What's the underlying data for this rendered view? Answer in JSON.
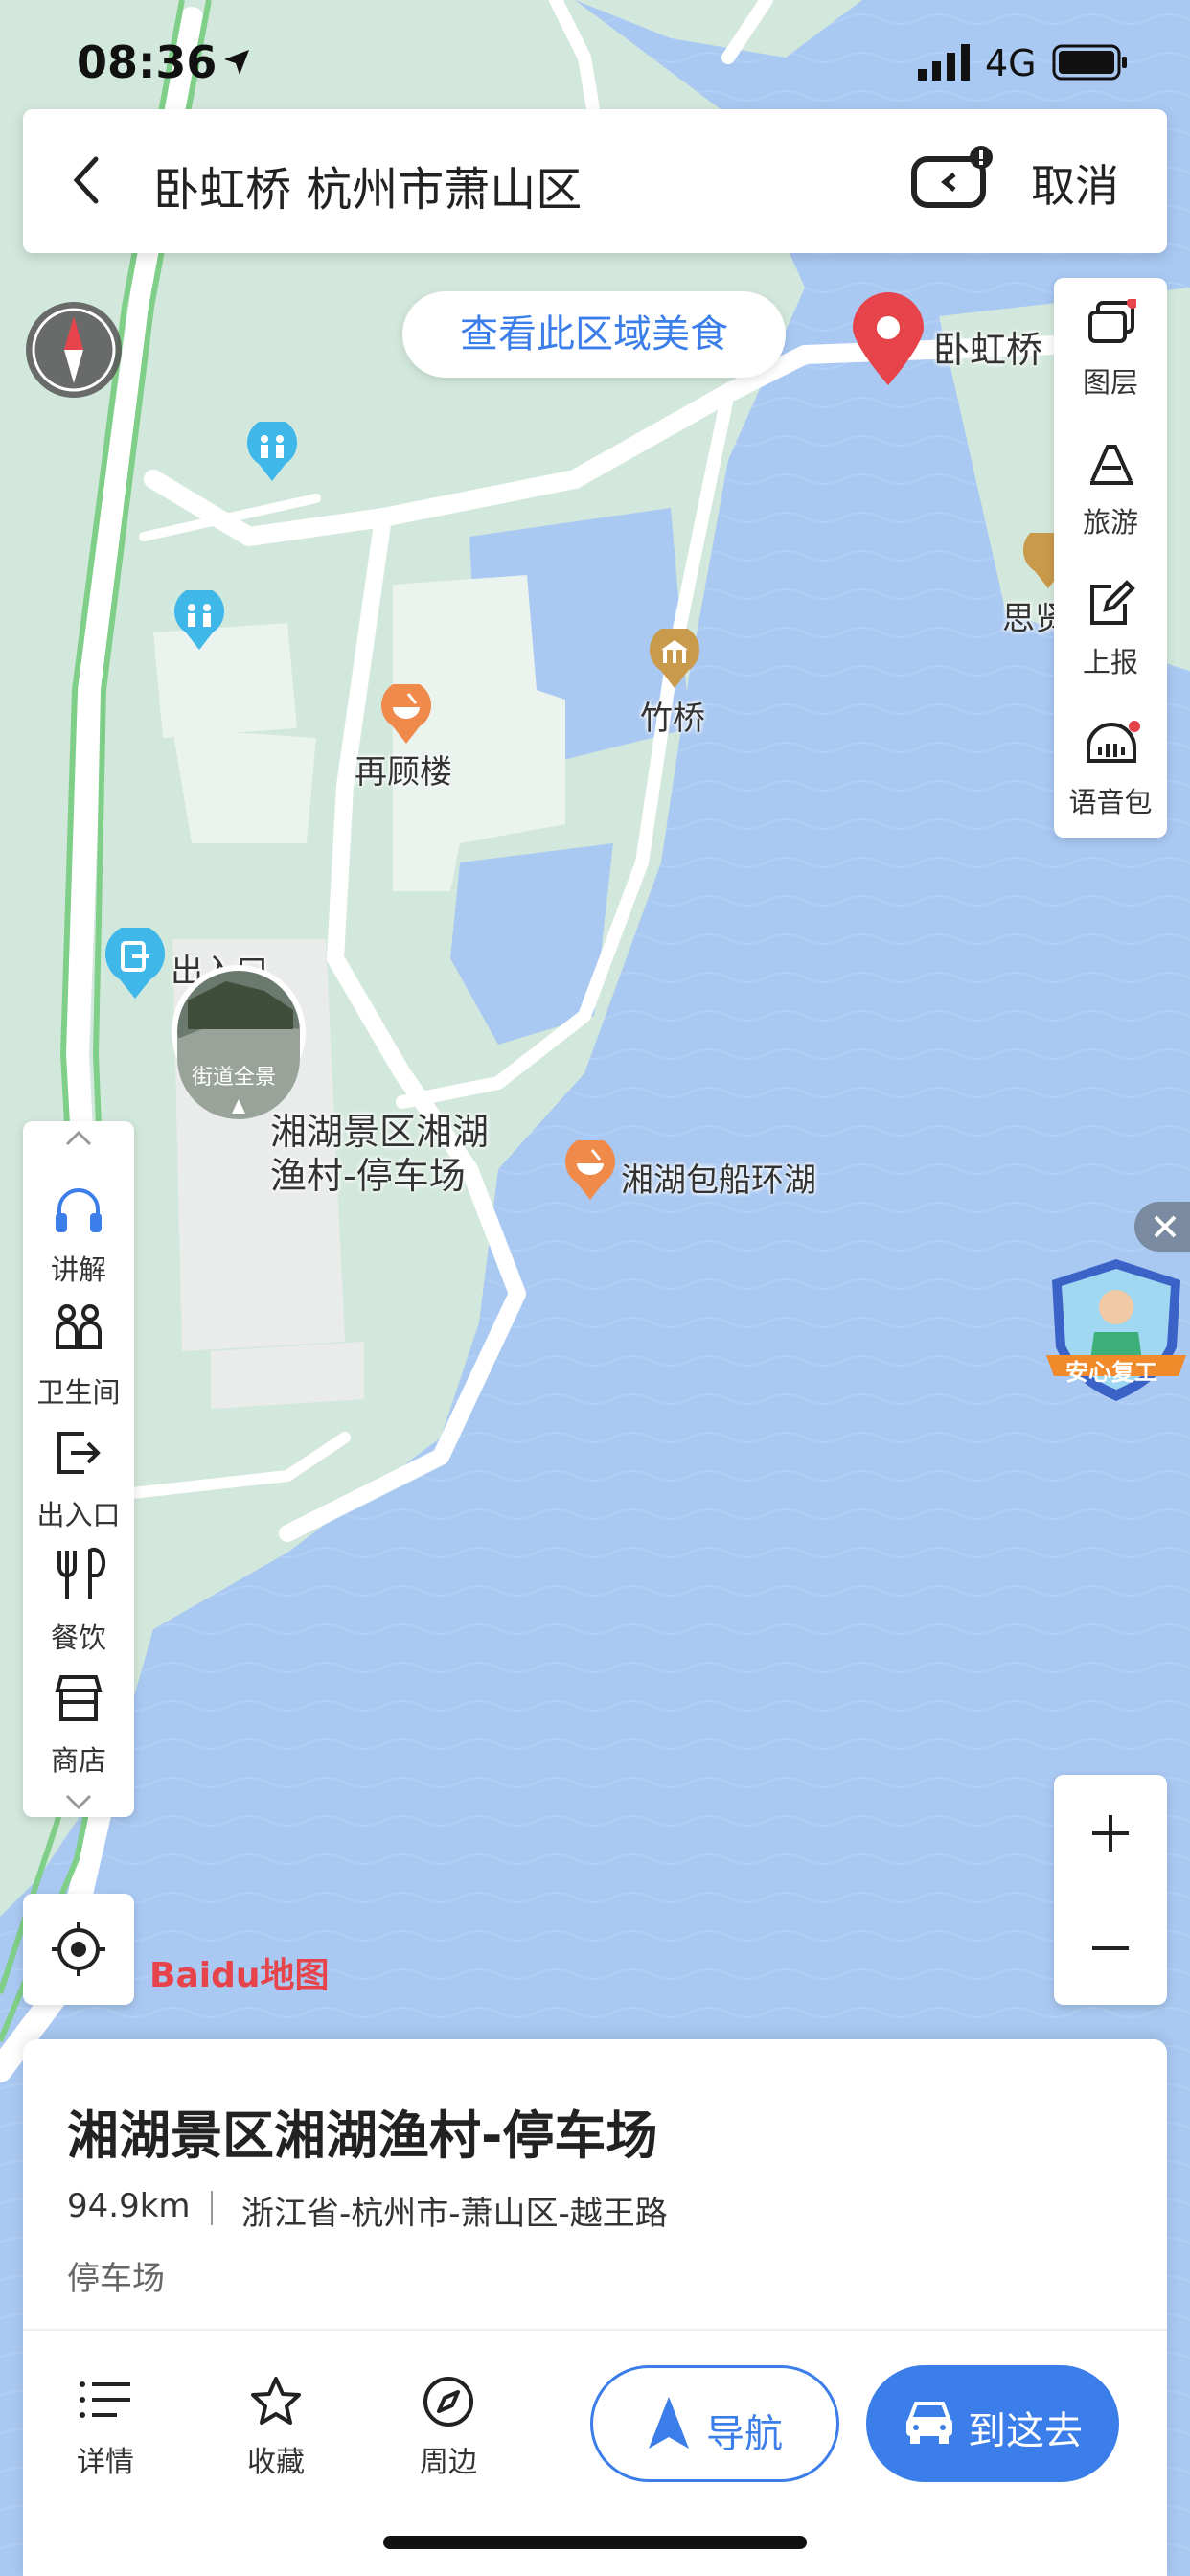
{
  "status_bar": {
    "time": "08:36",
    "network": "4G"
  },
  "search_bar": {
    "query": "卧虹桥 杭州市萧山区",
    "cancel_label": "取消"
  },
  "food_button": {
    "label": "查看此区域美食"
  },
  "right_toolbar": {
    "items": [
      {
        "label": "图层",
        "icon": "layers-icon"
      },
      {
        "label": "旅游",
        "icon": "travel-icon"
      },
      {
        "label": "上报",
        "icon": "report-icon"
      },
      {
        "label": "语音包",
        "icon": "voice-pack-icon"
      }
    ]
  },
  "left_toolbar": {
    "items": [
      {
        "label": "讲解",
        "icon": "headphones-icon"
      },
      {
        "label": "卫生间",
        "icon": "restroom-icon"
      },
      {
        "label": "出入口",
        "icon": "exit-icon"
      },
      {
        "label": "餐饮",
        "icon": "fork-knife-icon"
      },
      {
        "label": "商店",
        "icon": "shop-icon"
      }
    ]
  },
  "map": {
    "labels": {
      "pin": "卧虹桥",
      "zaigulou": "再顾楼",
      "zhuqiao": "竹桥",
      "parking_line1": "湘湖景区湘湖",
      "parking_line2": "渔村-停车场",
      "boat": "湘湖包船环湖",
      "exit": "出入口",
      "edge_poi": "思贤",
      "street_view": "街道全景",
      "campaign": "安心复工"
    },
    "logo": "Baidu地图",
    "colors": {
      "water": "#a9c8f2",
      "park": "#d3e8dc",
      "road": "#ffffff",
      "accent": "#3b7de9",
      "poi_orange": "#f08a4b",
      "pin_red": "#e6444a"
    }
  },
  "place_card": {
    "title": "湘湖景区湘湖渔村-停车场",
    "distance": "94.9km",
    "address": "浙江省-杭州市-萧山区-越王路",
    "category": "停车场",
    "actions": [
      {
        "label": "详情",
        "icon": "list-icon"
      },
      {
        "label": "收藏",
        "icon": "star-icon"
      },
      {
        "label": "周边",
        "icon": "compass-icon"
      }
    ],
    "navigate_label": "导航",
    "go_label": "到这去"
  }
}
